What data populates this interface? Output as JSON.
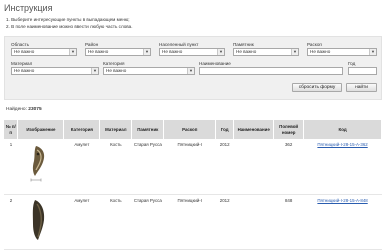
{
  "page": {
    "title": "Инструкция",
    "instructions": [
      "Выберите интересующие пункты в выпадающем меню;",
      "В поле наименование можно ввести любую часть слова."
    ]
  },
  "filters": {
    "region": {
      "label": "Область",
      "value": "Не важно"
    },
    "district": {
      "label": "Район",
      "value": "Не важно"
    },
    "settlement": {
      "label": "Населенный пункт",
      "value": "Не важно"
    },
    "monument": {
      "label": "Памятник",
      "value": "Не важно"
    },
    "excavation": {
      "label": "Раскоп",
      "value": "Не важно"
    },
    "material": {
      "label": "Материал",
      "value": "Не важно"
    },
    "category": {
      "label": "Категория",
      "value": "Не важно"
    },
    "name": {
      "label": "Наименование",
      "value": ""
    },
    "year": {
      "label": "Год",
      "value": ""
    },
    "reset_label": "сбросить форму",
    "search_label": "найти"
  },
  "results": {
    "found_label": "Найдено:",
    "count": "23075",
    "columns": [
      "№ п/п",
      "Изображение",
      "Категория",
      "Материал",
      "Памятник",
      "Раскоп",
      "Год",
      "Наименование",
      "Полевой номер",
      "Код"
    ],
    "rows": [
      {
        "num": "1",
        "category": "Амулет",
        "material": "Кость",
        "monument": "Старая Русса",
        "excavation": "Пятницкий-I",
        "year": "2012",
        "name": "",
        "field_no": "362",
        "code": "Пятницкий-I-28-15-А-362"
      },
      {
        "num": "2",
        "category": "Амулет",
        "material": "Кость",
        "monument": "Старая Русса",
        "excavation": "Пятницкий-I",
        "year": "2012",
        "name": "",
        "field_no": "848",
        "code": "Пятницкий-I-28-15-А-848"
      }
    ]
  },
  "colors": {
    "link": "#2a5db0",
    "panel": "#f0f0f0",
    "header": "#dadada"
  }
}
